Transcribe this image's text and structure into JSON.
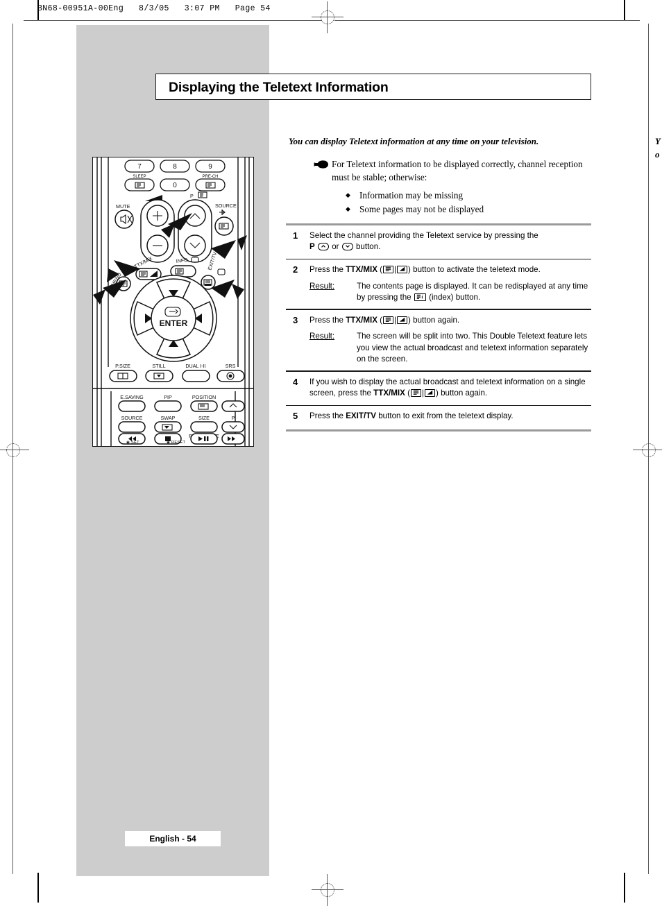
{
  "prepress": {
    "header": "BN68-00951A-00Eng   8/3/05   3:07 PM   Page 54"
  },
  "title": "Displaying the Teletext Information",
  "intro": {
    "lead": "You can display Teletext information at any time on your television.",
    "hand_icon": "pointing-hand-icon",
    "note": "For Teletext information to be displayed correctly, channel reception must be stable; otherwise:",
    "bullets": [
      "Information may be missing",
      "Some pages may not be displayed"
    ]
  },
  "steps": [
    {
      "num": "1",
      "text_a": "Select the channel providing the Teletext service by pressing the ",
      "bold_a": "P",
      "text_b": " or ",
      "text_c": " button."
    },
    {
      "num": "2",
      "text_a": "Press the ",
      "bold_a": "TTX/MIX",
      "text_b": " (",
      "text_c": ") button to activate the teletext mode.",
      "result_label": "Result:",
      "result_a": "The contents page is displayed. It can be redisplayed at any time by pressing the ",
      "result_b": " (index) button."
    },
    {
      "num": "3",
      "text_a": "Press the ",
      "bold_a": "TTX/MIX",
      "text_b": " (",
      "text_c": ") button again.",
      "result_label": "Result:",
      "result_a": "The screen will be split into two. This Double Teletext feature lets you view the actual broadcast and teletext information separately on the screen."
    },
    {
      "num": "4",
      "text_a": "If you wish to display the actual broadcast and teletext information on a single screen, press the ",
      "bold_a": "TTX/MIX",
      "text_b": " (",
      "text_c": ") button again."
    },
    {
      "num": "5",
      "text_a": "Press the ",
      "bold_a": "EXIT/TV",
      "text_b": " button to exit from the teletext display."
    }
  ],
  "remote": {
    "numbers": [
      "7",
      "8",
      "9"
    ],
    "zero": "0",
    "sleep": "SLEEP",
    "prech": "PRE-CH",
    "mute": "MUTE",
    "p_label": "P",
    "source": "SOURCE",
    "menu": "MENU",
    "ttxmix": "TTX/MIX",
    "info": "INFO",
    "exittv": "EXIT/TV",
    "enter": "ENTER",
    "row_media": [
      "P.SIZE",
      "STILL",
      "DUAL I-II",
      "SRS"
    ],
    "row_a": [
      "E.SAVING",
      "PIP",
      "POSITION"
    ],
    "row_b": [
      "SOURCE",
      "SWAP",
      "SIZE"
    ],
    "row_c": [
      "REW",
      "STOP",
      "PLAY/PAUSE",
      "FF"
    ],
    "p_side": "P",
    "set": "SET",
    "reset": "RESET"
  },
  "bleed": {
    "line1": "Y",
    "line2": "o"
  },
  "footer": "English - 54",
  "colors": {
    "panel_gray": "#cdcdcd",
    "rule_gray": "#9a9a9a",
    "ink": "#000000"
  }
}
